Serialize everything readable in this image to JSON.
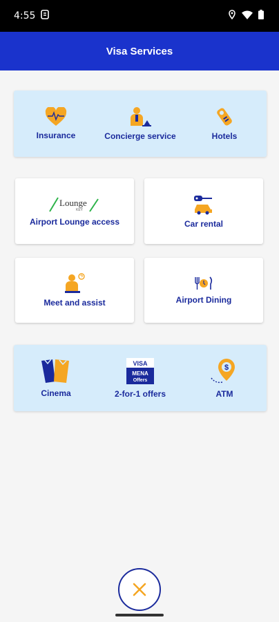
{
  "status_bar": {
    "time": "4:55"
  },
  "app_bar": {
    "title": "Visa Services"
  },
  "top_panel": {
    "items": [
      {
        "label": "Insurance",
        "icon": "heart-pulse-icon"
      },
      {
        "label": "Concierge service",
        "icon": "concierge-icon"
      },
      {
        "label": "Hotels",
        "icon": "door-hanger-icon"
      }
    ]
  },
  "cards": [
    {
      "label": "Airport Lounge access",
      "icon": "lounge-key-logo",
      "logo_text": "Lounge",
      "logo_subtext": "KEY"
    },
    {
      "label": "Car rental",
      "icon": "car-key-icon"
    },
    {
      "label": "Meet and assist",
      "icon": "meet-assist-icon"
    },
    {
      "label": "Airport Dining",
      "icon": "dining-icon"
    }
  ],
  "bottom_panel": {
    "items": [
      {
        "label": "Cinema",
        "icon": "cinema-tickets-icon"
      },
      {
        "label": "2-for-1 offers",
        "icon": "visa-mena-offers-icon",
        "badge_line1": "VISA",
        "badge_line2": "MENA",
        "badge_line3": "Offers"
      },
      {
        "label": "ATM",
        "icon": "atm-location-icon",
        "symbol": "$"
      }
    ]
  },
  "colors": {
    "primary_blue": "#1a33cc",
    "label_blue": "#1a2a9c",
    "accent_orange": "#f5a623",
    "panel_light_blue": "#d6ecfb"
  }
}
